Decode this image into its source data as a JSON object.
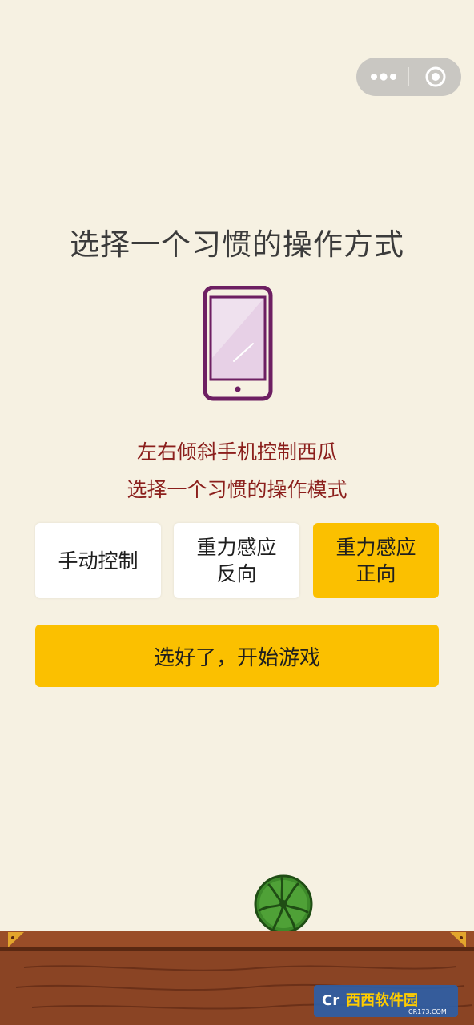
{
  "title": "选择一个习惯的操作方式",
  "hint_line1": "左右倾斜手机控制西瓜",
  "hint_line2": "选择一个习惯的操作模式",
  "options": [
    {
      "label": "手动控制",
      "selected": false
    },
    {
      "label": "重力感应\n反向",
      "selected": false
    },
    {
      "label": "重力感应\n正向",
      "selected": true
    }
  ],
  "start_button": "选好了，开始游戏",
  "icons": {
    "more": "more-dots-icon",
    "close": "target-close-icon",
    "phone": "phone-illustration",
    "melon": "watermelon-icon"
  },
  "watermark": {
    "brand": "西西软件园",
    "domain": "CR173.COM"
  },
  "colors": {
    "background": "#f6f1e2",
    "accent": "#fbc000",
    "hint_text": "#8b1f1c",
    "phone_purple": "#6d1f62"
  }
}
